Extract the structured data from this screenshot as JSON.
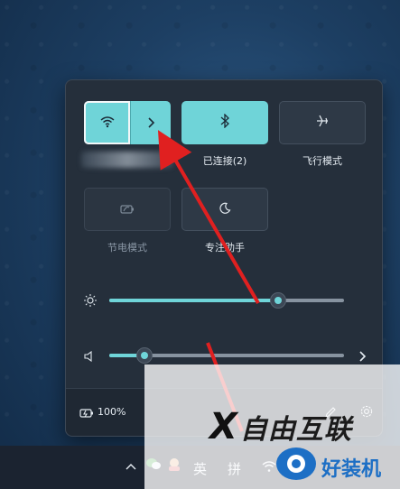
{
  "quick_settings": {
    "tiles": [
      {
        "id": "wifi",
        "label": "",
        "state": "on",
        "icon": "wifi-icon",
        "has_chevron": true
      },
      {
        "id": "bluetooth",
        "label": "已连接(2)",
        "state": "on",
        "icon": "bluetooth-icon"
      },
      {
        "id": "airplane",
        "label": "飞行模式",
        "state": "off",
        "icon": "airplane-icon"
      },
      {
        "id": "battery_saver",
        "label": "节电模式",
        "state": "disabled",
        "icon": "battery-saver-icon"
      },
      {
        "id": "focus_assist",
        "label": "专注助手",
        "state": "off",
        "icon": "moon-icon"
      }
    ],
    "brightness": {
      "icon": "sun-icon",
      "value_percent": 72
    },
    "volume": {
      "icon": "speaker-icon",
      "value_percent": 15
    },
    "footer": {
      "battery_icon": "battery-charging-icon",
      "battery_text": "100%",
      "edit_icon": "pencil-icon",
      "settings_icon": "gear-icon"
    }
  },
  "taskbar": {
    "chevron_icon": "chevron-up-icon",
    "ime_lang": "英",
    "ime_mode": "拼",
    "wifi_icon": "wifi-icon"
  },
  "watermarks": {
    "brand1": "自由互联",
    "brand1_prefix": "X",
    "brand2": "好装机"
  },
  "colors": {
    "accent": "#6fd4d8",
    "panel_bg": "#252f3b",
    "annotation_arrow": "#e02020"
  }
}
